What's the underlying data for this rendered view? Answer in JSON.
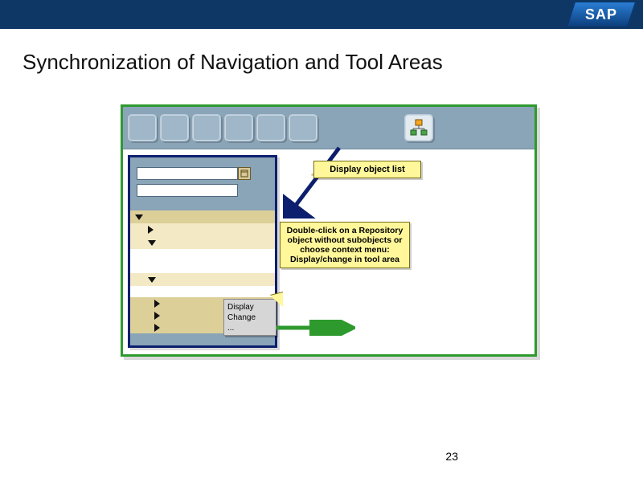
{
  "header": {
    "logo_text": "SAP"
  },
  "slide": {
    "title": "Synchronization of Navigation and Tool Areas",
    "page_number": "23"
  },
  "callouts": {
    "display_object_list": "Display object list",
    "double_click_info": "Double-click on a Repository object without subobjects or choose context menu: Display/change in tool area"
  },
  "context_menu": {
    "line1": "Display",
    "line2": "Change",
    "line3": "..."
  },
  "nav_inputs": {
    "field1": "",
    "field2": ""
  }
}
